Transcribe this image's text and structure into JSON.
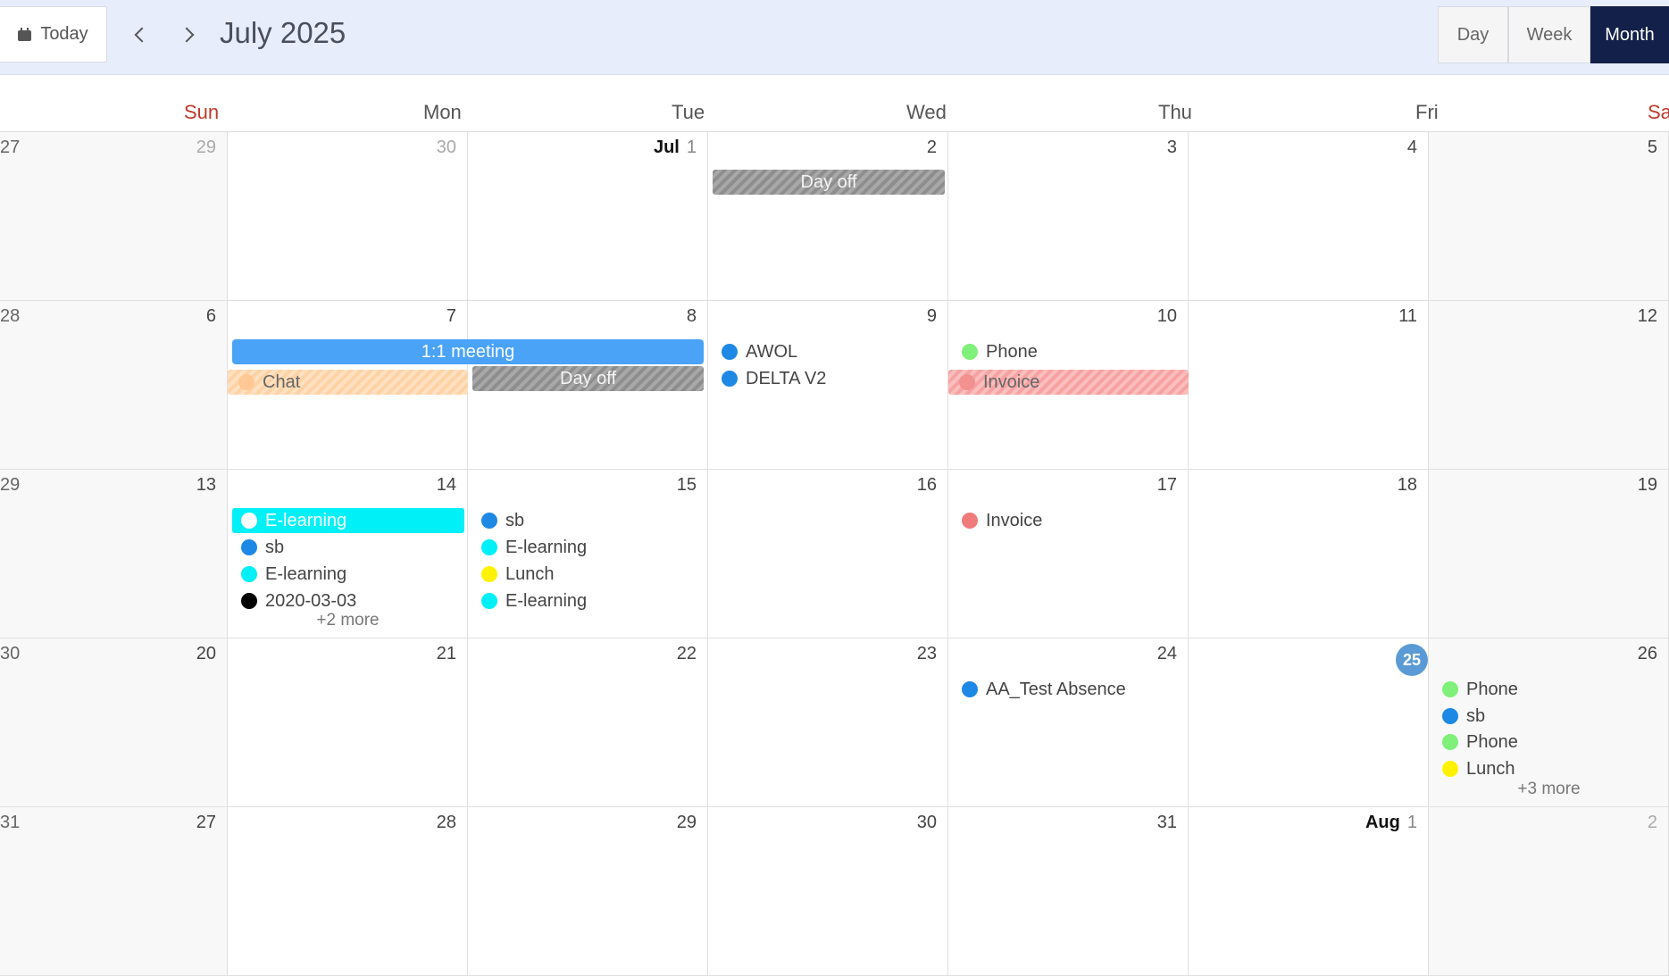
{
  "toolbar": {
    "today_label": "Today",
    "title": "July 2025",
    "views": [
      "Day",
      "Week",
      "Month"
    ],
    "active_view": "Month"
  },
  "weekdays": [
    "Sun",
    "Mon",
    "Tue",
    "Wed",
    "Thu",
    "Fri",
    "Sa"
  ],
  "weeks": [
    {
      "week": "27",
      "days": [
        "29",
        "30",
        "1",
        "2",
        "3",
        "4",
        "5"
      ],
      "muted": [
        true,
        true,
        false,
        false,
        false,
        false,
        false
      ],
      "month_label_index": 2,
      "month_label": "Jul"
    },
    {
      "week": "28",
      "days": [
        "6",
        "7",
        "8",
        "9",
        "10",
        "11",
        "12"
      ]
    },
    {
      "week": "29",
      "days": [
        "13",
        "14",
        "15",
        "16",
        "17",
        "18",
        "19"
      ]
    },
    {
      "week": "30",
      "days": [
        "20",
        "21",
        "22",
        "23",
        "24",
        "25",
        "26"
      ],
      "today_index": 5
    },
    {
      "week": "31",
      "days": [
        "27",
        "28",
        "29",
        "30",
        "31",
        "1",
        "2"
      ],
      "muted": [
        false,
        false,
        false,
        false,
        false,
        false,
        true
      ],
      "month_label_index": 5,
      "month_label": "Aug"
    }
  ],
  "events": {
    "day_off_1": "Day off",
    "meeting": "1:1 meeting",
    "chat": "Chat",
    "day_off_2": "Day off",
    "awol": "AWOL",
    "delta": "DELTA V2",
    "phone_10": "Phone",
    "invoice_10": "Invoice",
    "elearn_14_bar": "E-learning",
    "sb_14": "sb",
    "elearn_14": "E-learning",
    "date_14": "2020-03-03",
    "more_14": "+2 more",
    "sb_15": "sb",
    "elearn_15a": "E-learning",
    "lunch_15": "Lunch",
    "elearn_15b": "E-learning",
    "invoice_17": "Invoice",
    "absence_24": "AA_Test Absence",
    "phone_26a": "Phone",
    "sb_26": "sb",
    "phone_26b": "Phone",
    "lunch_26": "Lunch",
    "more_26": "+3 more"
  },
  "colors": {
    "blue": "#1e88e5",
    "meeting_blue": "#4aa3f7",
    "cyan": "#00f0f8",
    "green": "#7ff07a",
    "yellow": "#fff200",
    "black": "#000000",
    "red": "#f07b7b",
    "orange": "#ffd2a6",
    "toolbar_bg": "#e8edfb",
    "active_view_bg": "#13204a",
    "today_badge": "#5b9bd5"
  }
}
